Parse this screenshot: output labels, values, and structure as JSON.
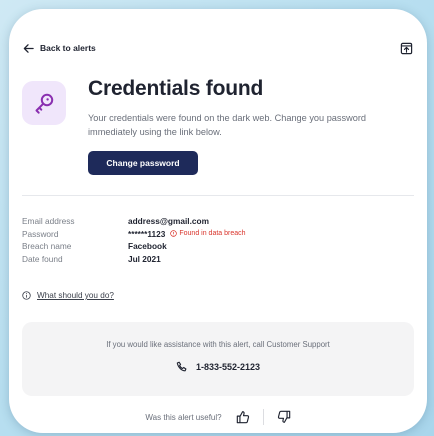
{
  "nav": {
    "back_label": "Back to alerts"
  },
  "alert": {
    "title": "Credentials found",
    "description": "Your credentials were found on the dark web. Change you password immediately using the link below.",
    "change_password_label": "Change password"
  },
  "details": [
    {
      "label": "Email address",
      "value": "address@gmail.com"
    },
    {
      "label": "Password",
      "value": "******1123",
      "note": "Found in data breach"
    },
    {
      "label": "Breach name",
      "value": "Facebook"
    },
    {
      "label": "Date found",
      "value": "Jul 2021"
    }
  ],
  "help_link": "What should you do?",
  "support": {
    "text": "If you would like assistance with this alert, call Customer Support",
    "phone": "1-833-552-2123"
  },
  "feedback": {
    "question": "Was this alert useful?"
  },
  "colors": {
    "primary_button": "#1e2a5a",
    "breach_red": "#d9342b",
    "key_tile_bg": "#f0e6fb",
    "key_icon": "#8a2fb0"
  },
  "icons": [
    "arrow-left-icon",
    "export-icon",
    "key-icon",
    "alert-circle-icon",
    "info-icon",
    "phone-icon",
    "thumbs-up-icon",
    "thumbs-down-icon"
  ]
}
